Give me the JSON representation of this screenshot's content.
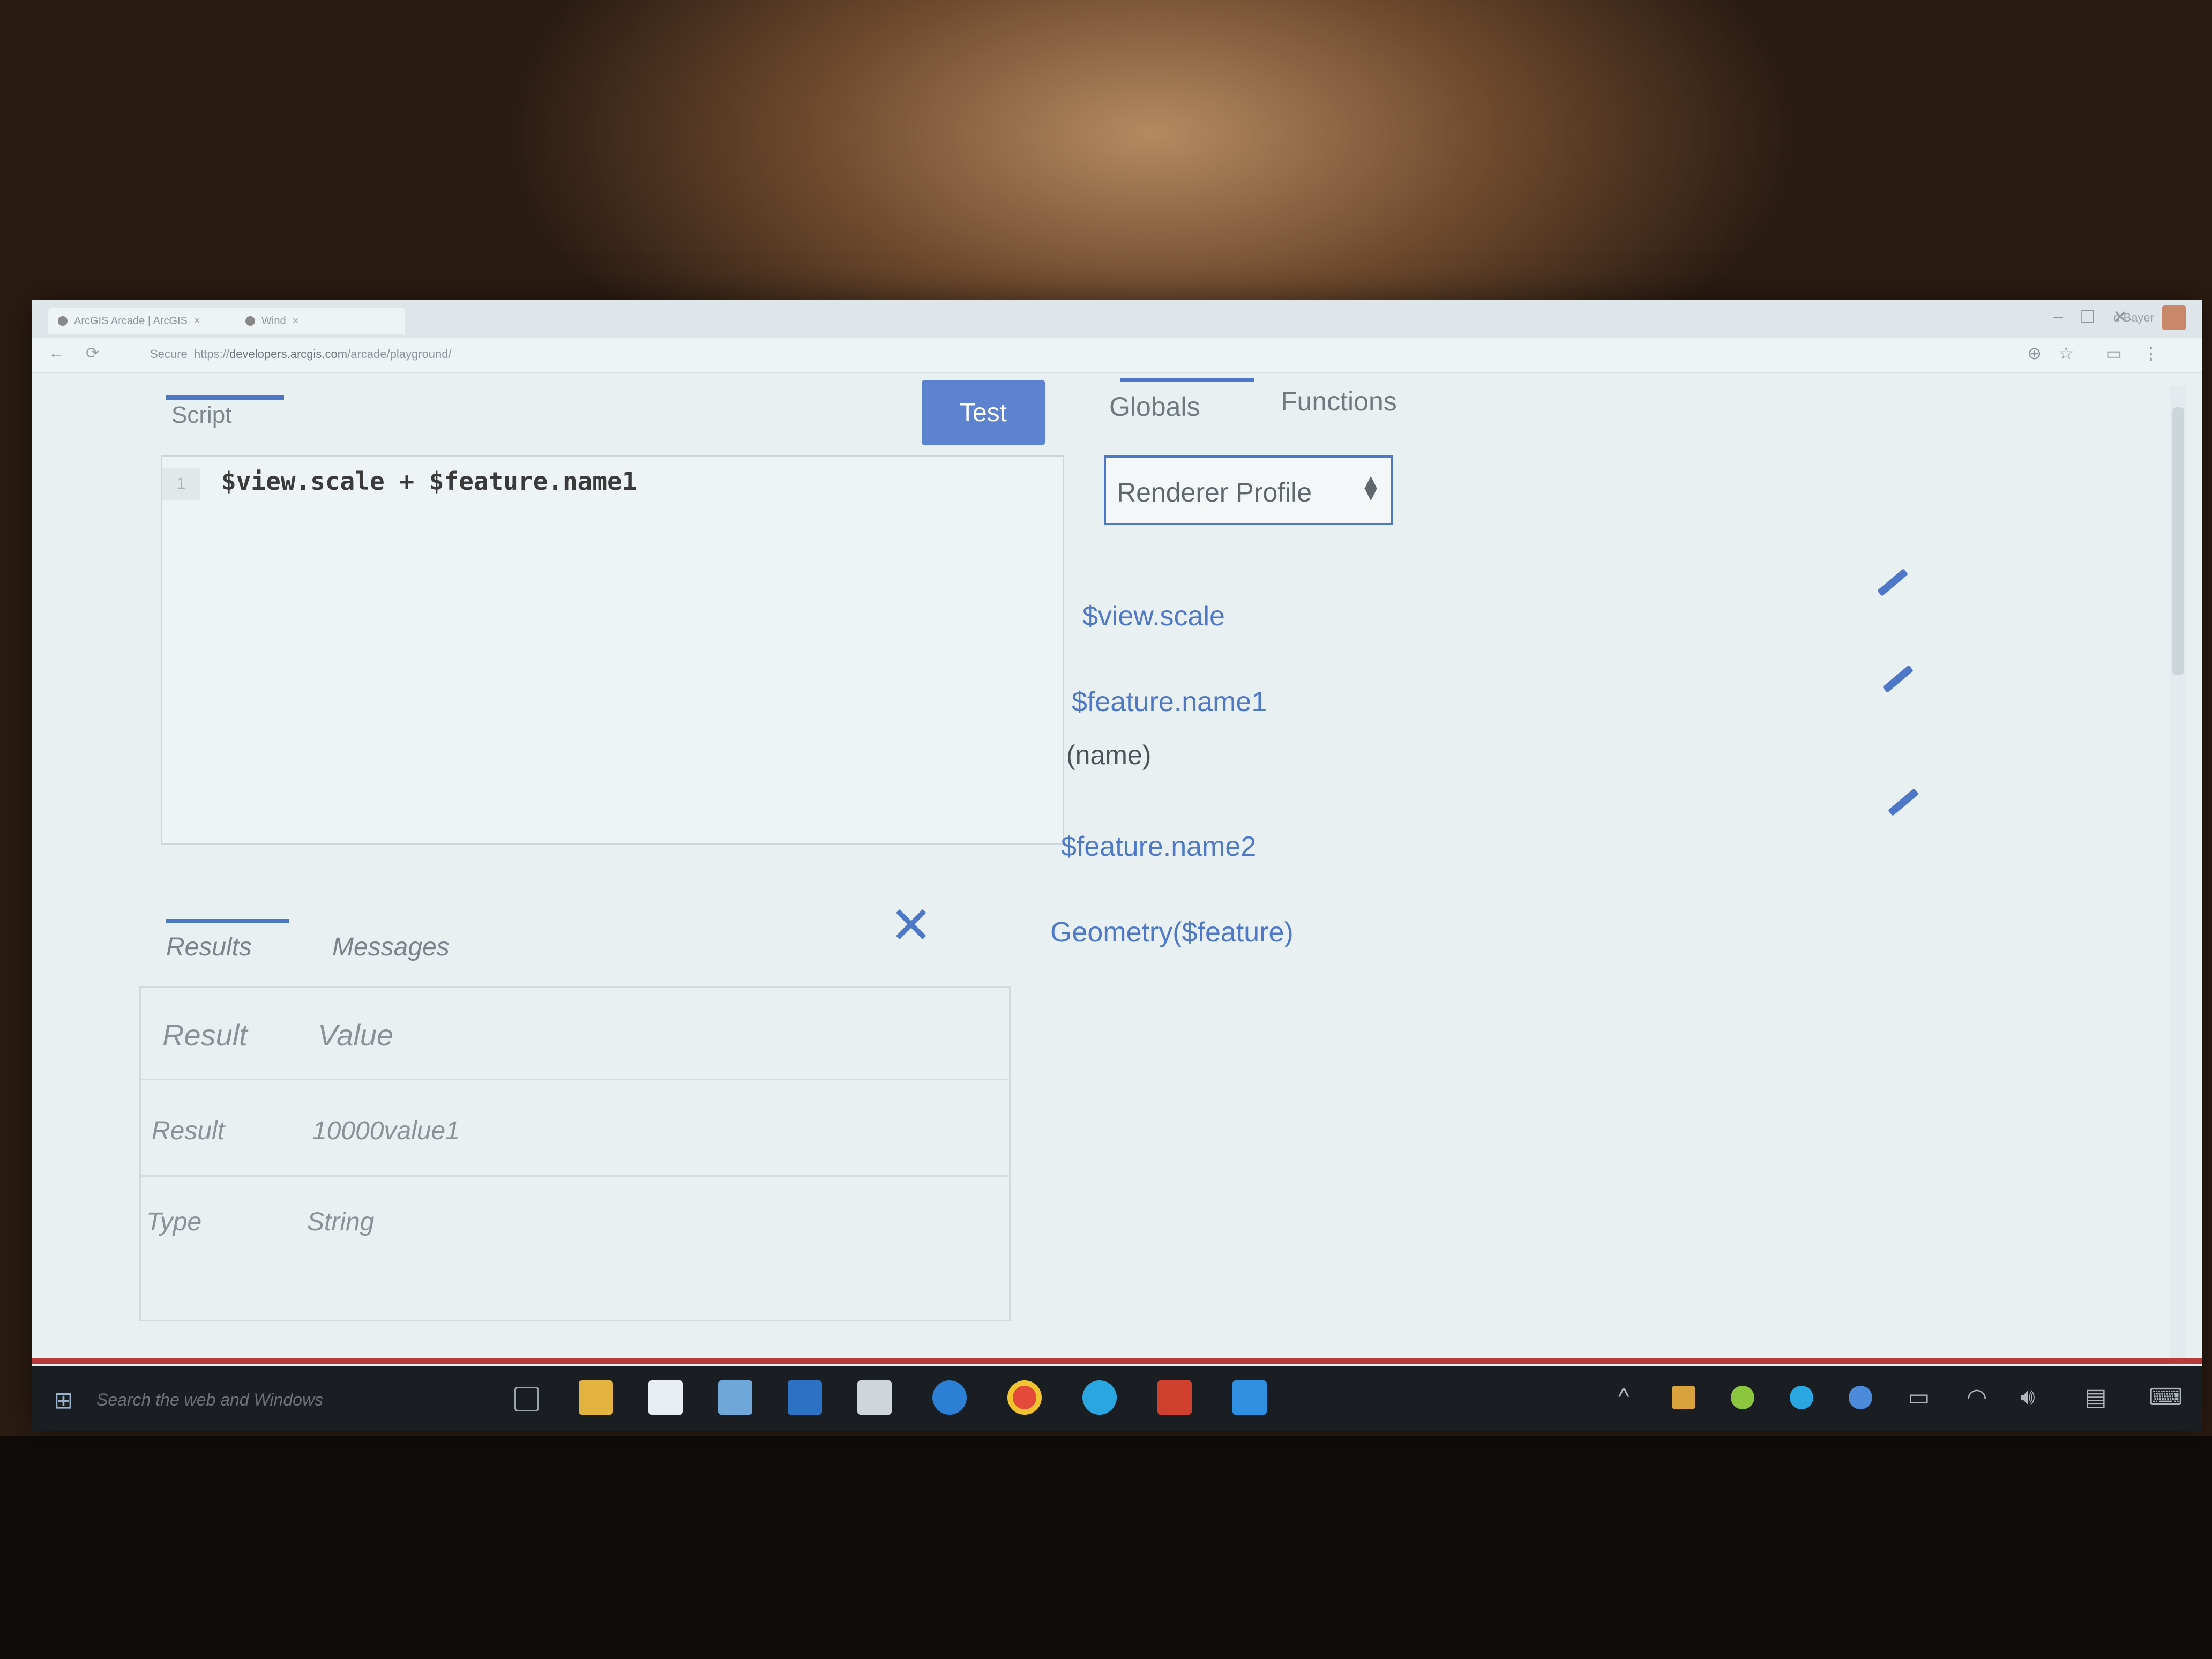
{
  "browser": {
    "tabs": [
      {
        "label": "ArcGIS Arcade | ArcGIS"
      },
      {
        "label": "Wind"
      }
    ],
    "user_label": "d Bayer",
    "secure_label": "Secure",
    "url_prefix": "https://",
    "url_domain": "developers.arcgis.com",
    "url_path": "/arcade/playground/"
  },
  "editor": {
    "tab_label": "Script",
    "test_button": "Test",
    "line_number": "1",
    "code": "$view.scale + $feature.name1"
  },
  "results": {
    "tabs": [
      "Results",
      "Messages"
    ],
    "header": {
      "col1": "Result",
      "col2": "Value"
    },
    "rows": [
      {
        "key": "Result",
        "value": "10000value1"
      },
      {
        "key": "Type",
        "value": "String"
      }
    ]
  },
  "globals_panel": {
    "tabs": [
      "Globals",
      "Functions"
    ],
    "profile_select": "Renderer Profile",
    "items": [
      {
        "name": "$view.scale",
        "sub": ""
      },
      {
        "name": "$feature.name1",
        "sub": "(name)"
      },
      {
        "name": "$feature.name2",
        "sub": ""
      },
      {
        "name": "Geometry($feature)",
        "sub": ""
      }
    ]
  },
  "taskbar": {
    "search_placeholder": "Search the web and Windows"
  },
  "colors": {
    "accent": "#4f77c7",
    "test_button": "#5d82cf",
    "taskbar": "#1a1d22"
  }
}
